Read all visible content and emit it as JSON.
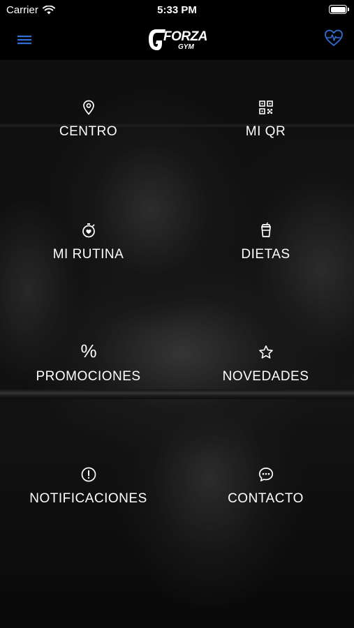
{
  "status_bar": {
    "carrier": "Carrier",
    "time": "5:33 PM"
  },
  "header": {
    "brand": "FORZA",
    "brand_sub": "GYM",
    "menu_icon": "hamburger-menu-icon",
    "action_icon": "heart-pulse-icon",
    "accent_color": "#2f6fd6"
  },
  "menu": {
    "items": [
      {
        "label": "CENTRO",
        "icon": "location-pin-icon"
      },
      {
        "label": "MI QR",
        "icon": "qr-code-icon"
      },
      {
        "label": "MI RUTINA",
        "icon": "stopwatch-heart-icon"
      },
      {
        "label": "DIETAS",
        "icon": "drink-cup-icon"
      },
      {
        "label": "PROMOCIONES",
        "icon": "percent-icon"
      },
      {
        "label": "NOVEDADES",
        "icon": "star-icon"
      },
      {
        "label": "NOTIFICACIONES",
        "icon": "alert-circle-icon"
      },
      {
        "label": "CONTACTO",
        "icon": "chat-bubble-icon"
      }
    ]
  }
}
